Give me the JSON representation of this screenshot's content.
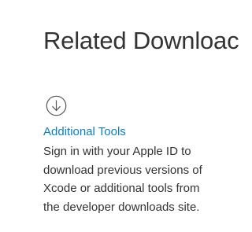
{
  "section": {
    "heading": "Related Downloac"
  },
  "tool": {
    "icon": "download-arrow-circle-icon",
    "link_label": "Additional Tools",
    "description_lines": [
      "Sign in with your Apple ID to",
      "download previous versions of",
      "Xcode or additional tools from",
      "the developer downloads site."
    ]
  },
  "colors": {
    "link": "#0a7fc4",
    "text": "#333333",
    "icon": "#555555"
  }
}
